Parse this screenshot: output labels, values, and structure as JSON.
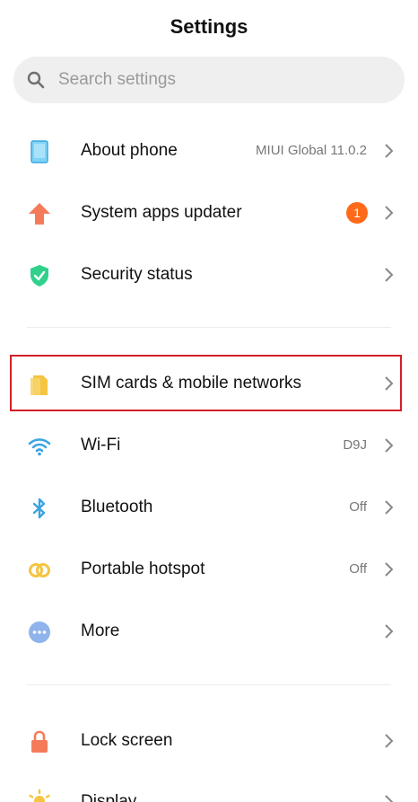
{
  "header": {
    "title": "Settings"
  },
  "search": {
    "placeholder": "Search settings",
    "icon": "search-icon"
  },
  "items": [
    {
      "id": "about-phone",
      "label": "About phone",
      "value": "MIUI Global 11.0.2",
      "icon": "phone-icon",
      "color": "#4fc3f7"
    },
    {
      "id": "system-apps-updater",
      "label": "System apps updater",
      "badge": "1",
      "icon": "up-arrow-icon",
      "color": "#f47b5a"
    },
    {
      "id": "security-status",
      "label": "Security status",
      "icon": "shield-icon",
      "color": "#2fd18b"
    },
    {
      "id": "sim-cards",
      "label": "SIM cards & mobile networks",
      "icon": "sim-card-icon",
      "color": "#f4c542",
      "highlighted": true
    },
    {
      "id": "wifi",
      "label": "Wi-Fi",
      "value": "D9J",
      "icon": "wifi-icon",
      "color": "#3aa3e3"
    },
    {
      "id": "bluetooth",
      "label": "Bluetooth",
      "value": "Off",
      "icon": "bluetooth-icon",
      "color": "#3aa3e3"
    },
    {
      "id": "portable-hotspot",
      "label": "Portable hotspot",
      "value": "Off",
      "icon": "hotspot-icon",
      "color": "#f4c542"
    },
    {
      "id": "more",
      "label": "More",
      "icon": "more-dots-icon",
      "color": "#8fb3ea"
    },
    {
      "id": "lock-screen",
      "label": "Lock screen",
      "icon": "lock-icon",
      "color": "#f47b5a"
    },
    {
      "id": "display",
      "label": "Display",
      "icon": "sun-icon",
      "color": "#f4c542"
    }
  ],
  "colors": {
    "accent_badge": "#ff6a1a",
    "highlight_border": "#d32028"
  }
}
